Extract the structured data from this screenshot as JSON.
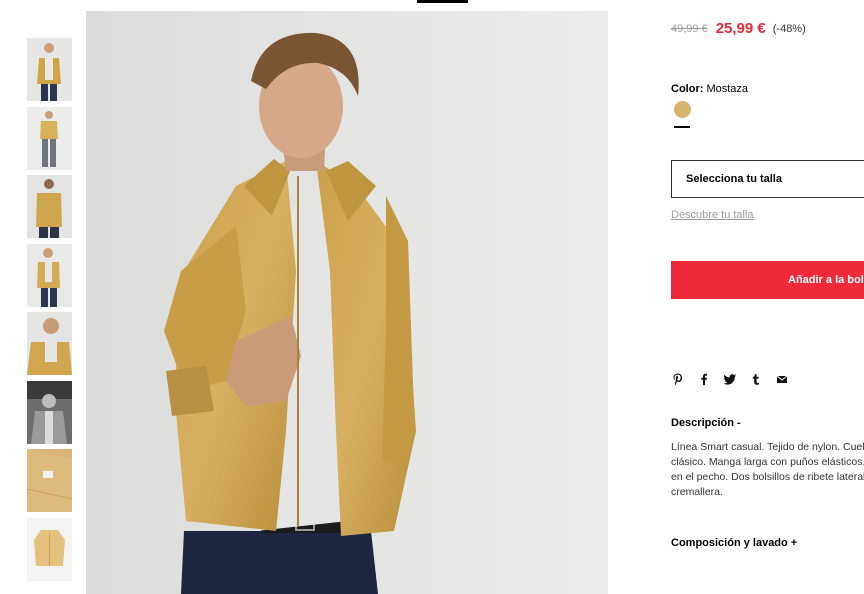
{
  "product": {
    "old_price": "49,99 €",
    "new_price": "25,99 €",
    "discount": "(-48%)",
    "price_color": "#e5283a"
  },
  "color": {
    "label": "Color:",
    "value": "Mostaza",
    "swatch_hex": "#d6b46c"
  },
  "size": {
    "select_label": "Selecciona tu talla",
    "guide_link": "Descubre tu talla"
  },
  "cart": {
    "add_label": "Añadir a la bolsa",
    "button_color": "#f0293b"
  },
  "share": {
    "icons": [
      "pinterest-icon",
      "facebook-icon",
      "twitter-icon",
      "tumblr-icon",
      "email-icon"
    ]
  },
  "description": {
    "title": "Descripción -",
    "lines": [
      "Línea Smart casual. Tejido de nylon. Cuello",
      "clásico. Manga larga con puños elásticos. Bolsillo",
      "en el pecho. Dos bolsillos de ribete laterales. Cierre",
      "cremallera."
    ]
  },
  "composition": {
    "title": "Composición y lavado +"
  },
  "gallery": {
    "thumbnail_count": 8
  }
}
